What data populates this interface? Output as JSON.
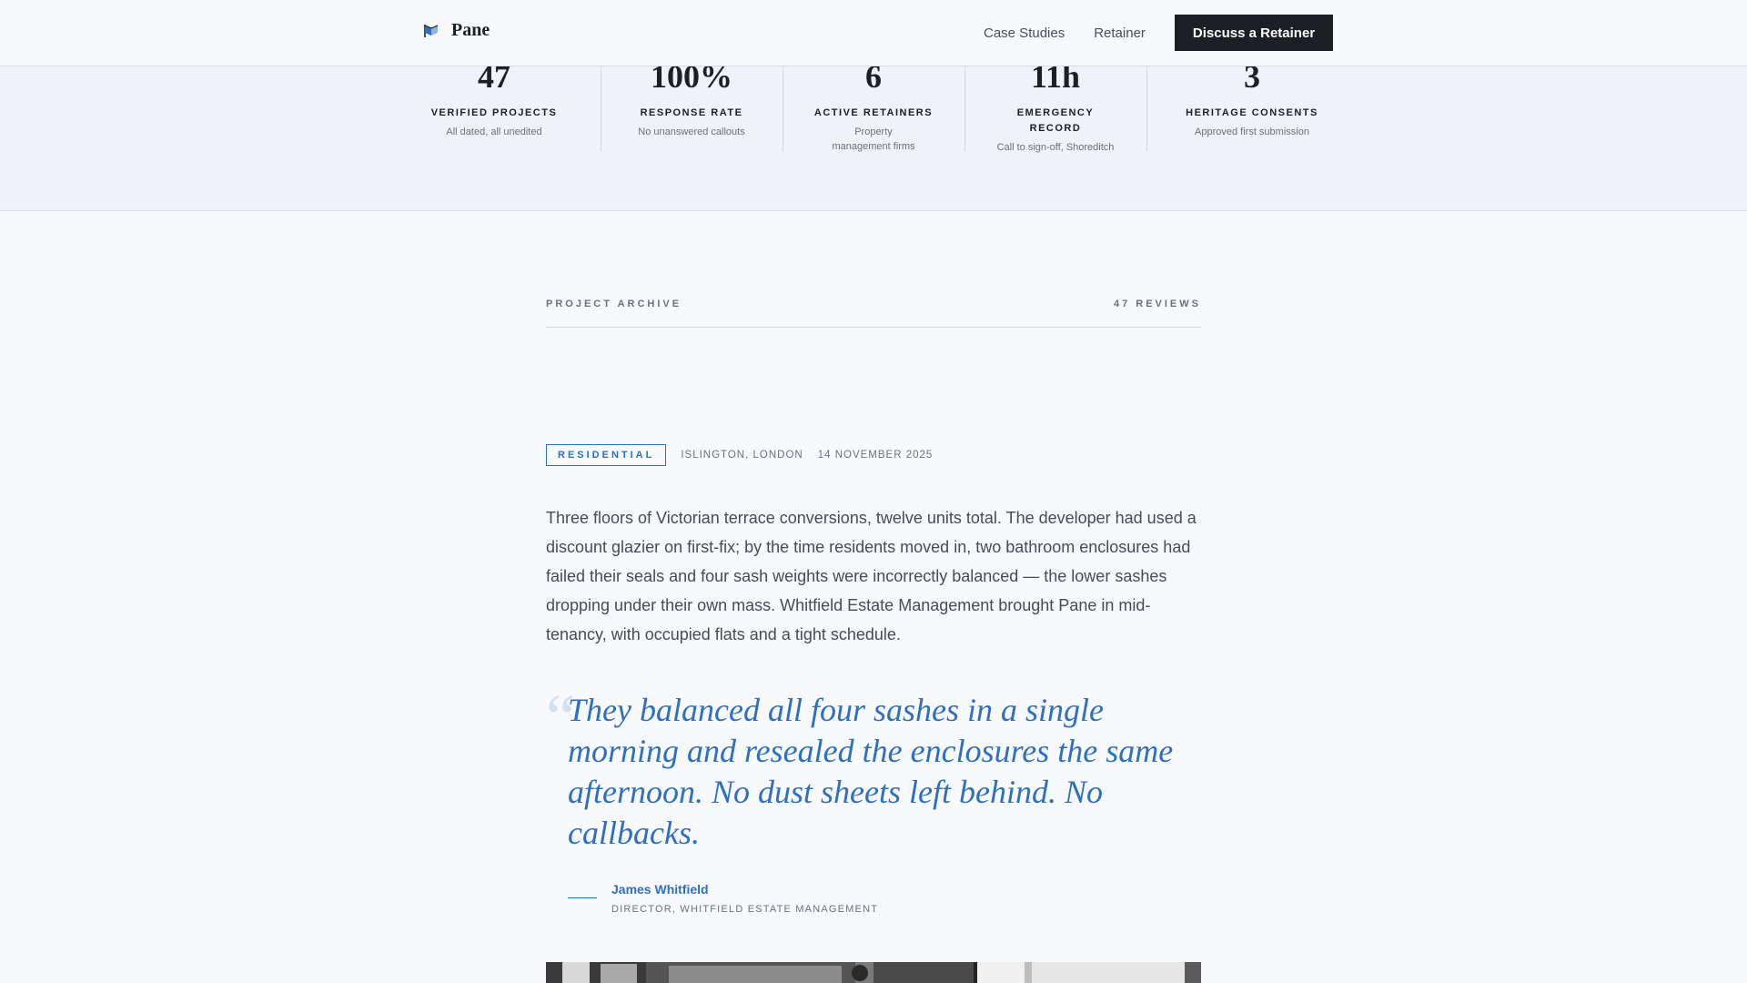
{
  "header": {
    "brand": "Pane",
    "brand_icon": "flag-icon",
    "nav": [
      "Case Studies",
      "Retainer"
    ],
    "cta": "Discuss a Retainer"
  },
  "stats": [
    {
      "value": "47",
      "label": "VERIFIED PROJECTS",
      "sub": "All dated, all unedited"
    },
    {
      "value": "100%",
      "label": "RESPONSE RATE",
      "sub": "No unanswered callouts"
    },
    {
      "value": "6",
      "label": "ACTIVE RETAINERS",
      "sub": "Property management firms"
    },
    {
      "value": "11h",
      "label": "EMERGENCY RECORD",
      "sub": "Call to sign-off, Shoreditch"
    },
    {
      "value": "3",
      "label": "HERITAGE CONSENTS",
      "sub": "Approved first submission"
    }
  ],
  "archive": {
    "title": "PROJECT ARCHIVE",
    "count": "47 REVIEWS"
  },
  "entry": {
    "category": "RESIDENTIAL",
    "location": "ISLINGTON, LONDON",
    "date": "14 NOVEMBER 2025",
    "body": "Three floors of Victorian terrace conversions, twelve units total. The developer had used a discount glazier on first-fix; by the time residents moved in, two bathroom enclosures had failed their seals and four sash weights were incorrectly balanced — the lower sashes dropping under their own mass. Whitfield Estate Management brought Pane in mid-tenancy, with occupied flats and a tight schedule.",
    "quote": "They balanced all four sashes in a single morning and resealed the enclosures the same afternoon. No dust sheets left behind. No callbacks.",
    "author": "James Whitfield",
    "author_role": "DIRECTOR, WHITFIELD ESTATE MANAGEMENT"
  },
  "colors": {
    "accent": "#2f6fc0",
    "dark": "#1c1f24",
    "background": "#f7f9fc"
  }
}
